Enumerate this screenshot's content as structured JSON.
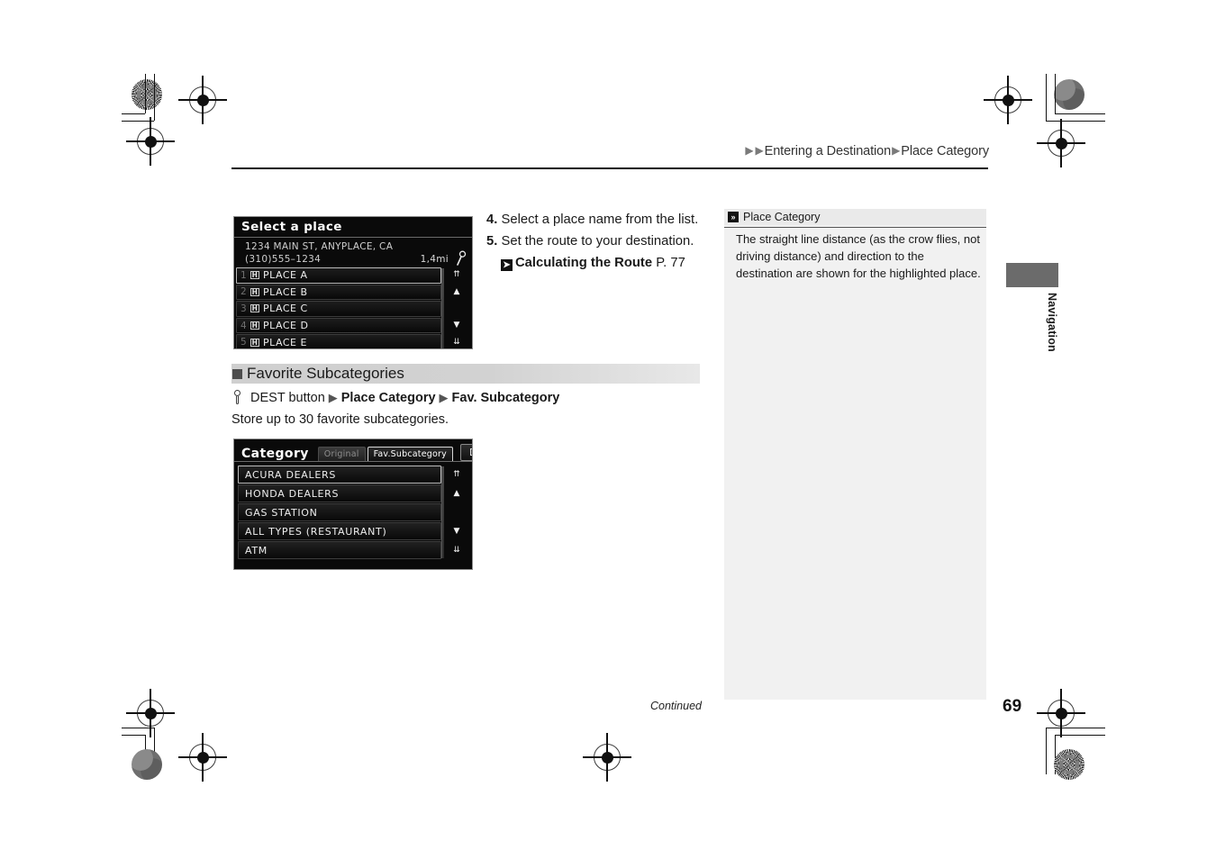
{
  "header": {
    "breadcrumb_parts": [
      "Entering a Destination",
      "Place Category"
    ],
    "tri": "▶"
  },
  "steps": [
    {
      "num": "4.",
      "text": "Select a place name from the list."
    },
    {
      "num": "5.",
      "text": "Set the route to your destination."
    }
  ],
  "step_reference": {
    "icon": "➤",
    "bold_text": "Calculating the Route",
    "page_ref": "P. 77"
  },
  "section": {
    "title": "Favorite Subcategories",
    "nav_path": {
      "button_label": "DEST button",
      "step1": "Place Category",
      "step2": "Fav. Subcategory",
      "arrow": "▶"
    },
    "description": "Store up to 30 favorite subcategories."
  },
  "screen1": {
    "title": "Select a place",
    "address_line1": "1234 MAIN ST, ANYPLACE, CA",
    "address_line2": "(310)555–1234",
    "distance": "1,4mi",
    "rows": [
      {
        "index": "1",
        "label": "PLACE A",
        "selected": true
      },
      {
        "index": "2",
        "label": "PLACE B",
        "selected": false
      },
      {
        "index": "3",
        "label": "PLACE C",
        "selected": false
      },
      {
        "index": "4",
        "label": "PLACE D",
        "selected": false
      },
      {
        "index": "5",
        "label": "PLACE E",
        "selected": false
      }
    ],
    "scroll_buttons": [
      "⇈",
      "▲",
      "",
      "▼",
      "⇊"
    ]
  },
  "screen2": {
    "title": "Category",
    "tabs": [
      {
        "label": "Original",
        "active": false
      },
      {
        "label": "Fav.Subcategory",
        "active": true
      }
    ],
    "delete_label": "Delete",
    "rows": [
      {
        "label": "ACURA DEALERS",
        "selected": true
      },
      {
        "label": "HONDA DEALERS",
        "selected": false
      },
      {
        "label": "GAS STATION",
        "selected": false
      },
      {
        "label": "ALL TYPES (RESTAURANT)",
        "selected": false
      },
      {
        "label": "ATM",
        "selected": false
      }
    ],
    "scroll_buttons": [
      "⇈",
      "▲",
      "",
      "▼",
      "⇊"
    ]
  },
  "note": {
    "icon": "»",
    "title": "Place Category",
    "body": "The straight line distance (as the crow flies, not driving distance) and direction to the destination are shown for the highlighted place."
  },
  "side_tab": {
    "label": "Navigation"
  },
  "footer": {
    "continued": "Continued",
    "page_number": "69"
  },
  "colors": {
    "screen_bg": "#0a0a0a",
    "note_bg": "#f1f1f1",
    "section_bar": "#cfcfcf",
    "side_tab": "#6b6b6b"
  }
}
